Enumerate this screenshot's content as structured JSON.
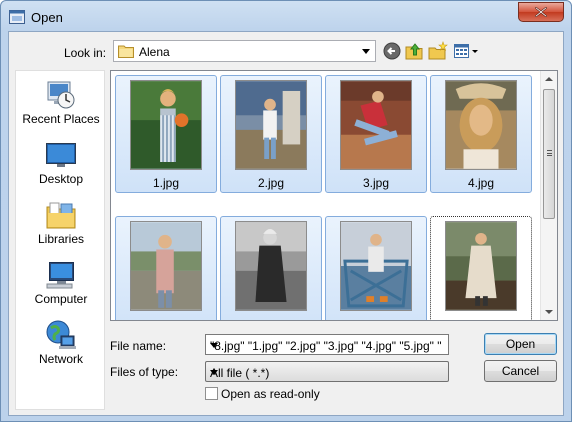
{
  "window": {
    "title": "Open"
  },
  "lookin": {
    "label": "Look in:",
    "value": "Alena"
  },
  "toolbar": {
    "icons": [
      "back-icon",
      "up-folder-icon",
      "new-folder-icon",
      "view-menu-icon"
    ]
  },
  "places": [
    {
      "label": "Recent Places",
      "icon": "recent-places-icon"
    },
    {
      "label": "Desktop",
      "icon": "desktop-icon"
    },
    {
      "label": "Libraries",
      "icon": "libraries-icon"
    },
    {
      "label": "Computer",
      "icon": "computer-icon"
    },
    {
      "label": "Network",
      "icon": "network-icon"
    }
  ],
  "files": [
    {
      "name": "1.jpg",
      "selected": true
    },
    {
      "name": "2.jpg",
      "selected": true
    },
    {
      "name": "3.jpg",
      "selected": true
    },
    {
      "name": "4.jpg",
      "selected": true
    },
    {
      "name": "",
      "selected": true
    },
    {
      "name": "",
      "selected": true
    },
    {
      "name": "",
      "selected": true
    },
    {
      "name": "",
      "selected": true,
      "focused": true
    }
  ],
  "filename": {
    "label": "File name:",
    "value": "\"8.jpg\" \"1.jpg\" \"2.jpg\" \"3.jpg\" \"4.jpg\" \"5.jpg\" \""
  },
  "filetype": {
    "label": "Files of type:",
    "value": "All file ( *.*)"
  },
  "readonly": {
    "label": "Open as read-only",
    "checked": false
  },
  "buttons": {
    "open": "Open",
    "cancel": "Cancel"
  },
  "colors": {
    "selection": "#cfe2f8",
    "selection_border": "#84acdd",
    "title_gradient": "#cfe0f2"
  }
}
